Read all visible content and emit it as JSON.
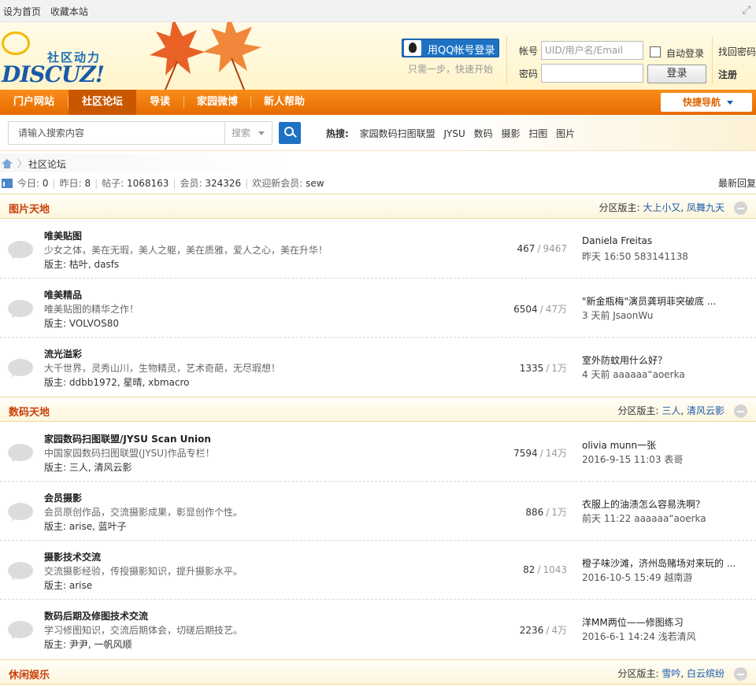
{
  "topbar": {
    "set_home": "设为首页",
    "bookmark": "收藏本站"
  },
  "header": {
    "logo_tagline": "社区动力",
    "logo_brand": "DISCUZ!",
    "qq_login": "用QQ帐号登录",
    "qq_sub": "只需一步，快速开始",
    "account_label": "帐号",
    "account_placeholder": "UID/用户名/Email",
    "password_label": "密码",
    "auto_login": "自动登录",
    "login_button": "登录",
    "forgot_password": "找回密码",
    "register": "注册"
  },
  "nav": {
    "items": [
      "门户网站",
      "社区论坛",
      "导读",
      "家园微博",
      "新人帮助"
    ],
    "active": "社区论坛",
    "quick_nav": "快捷导航"
  },
  "search": {
    "placeholder": "请输入搜索内容",
    "type": "搜索",
    "hot_label": "热搜:",
    "hot_keywords": [
      "家园数码扫图联盟",
      "JYSU",
      "数码",
      "摄影",
      "扫图",
      "图片"
    ]
  },
  "breadcrumb": {
    "current": "社区论坛"
  },
  "stats": {
    "today_label": "今日:",
    "today": "0",
    "yesterday_label": "昨日:",
    "yesterday": "8",
    "posts_label": "帖子:",
    "posts": "1068163",
    "members_label": "会员:",
    "members": "324326",
    "welcome_label": "欢迎新会员:",
    "new_member": "sew",
    "latest_reply": "最新回复"
  },
  "sections": [
    {
      "title": "图片天地",
      "mods_label": "分区版主:",
      "mods": [
        "大上小又",
        "凤舞九天"
      ],
      "forums": [
        {
          "name": "唯美贴图",
          "desc": "少女之体，美在无瑕，美人之躯，美在质雅，爱人之心，美在升华！",
          "moderators": "版主: 枯叶, dasfs",
          "threads": "467",
          "posts": "9467",
          "last_title": "Daniela Freitas",
          "last_meta": "昨天 16:50 583141138"
        },
        {
          "name": "唯美精品",
          "desc": "唯美贴图的精华之作！",
          "moderators": "版主: VOLVOS80",
          "threads": "6504",
          "posts": "47万",
          "last_title": "\"新金瓶梅\"演员龚玥菲突破底 ...",
          "last_meta": "3 天前 JsaonWu"
        },
        {
          "name": "流光溢彩",
          "desc": "大千世界，灵秀山川，生物精灵，艺术奇葩，无尽瑕想！",
          "moderators": "版主: ddbb1972, 星晴, xbmacro",
          "threads": "1335",
          "posts": "1万",
          "last_title": "室外防蚊用什么好？",
          "last_meta": "4 天前 aaaaaa“aoerka"
        }
      ]
    },
    {
      "title": "数码天地",
      "mods_label": "分区版主:",
      "mods": [
        "三人",
        "清风云影"
      ],
      "forums": [
        {
          "name": "家园数码扫图联盟/JYSU Scan Union",
          "desc": "中国家园数码扫图联盟(JYSU)作品专栏！",
          "moderators": "版主: 三人, 清风云影",
          "threads": "7594",
          "posts": "14万",
          "last_title": "olivia munn一张",
          "last_meta": "2016-9-15 11:03 表哥"
        },
        {
          "name": "会员摄影",
          "desc": "会员原创作品，交流摄影成果，彰显创作个性。",
          "moderators": "版主: arise, 蓝叶子",
          "threads": "886",
          "posts": "1万",
          "last_title": "衣服上的油渍怎么容易洗啊？",
          "last_meta": "前天 11:22 aaaaaa“aoerka"
        },
        {
          "name": "摄影技术交流",
          "desc": "交流摄影经验，传授摄影知识，提升摄影水平。",
          "moderators": "版主: arise",
          "threads": "82",
          "posts": "1043",
          "last_title": "橙子味沙滩，济州岛赌场对来玩的 ...",
          "last_meta": "2016-10-5 15:49 越南游"
        },
        {
          "name": "数码后期及修图技术交流",
          "desc": "学习修图知识，交流后期体会，切磋后期技艺。",
          "moderators": "版主: 尹尹, 一帆风顺",
          "threads": "2236",
          "posts": "4万",
          "last_title": "洋MM两位——修图练习",
          "last_meta": "2016-6-1 14:24 浅若清风"
        }
      ]
    },
    {
      "title": "休闲娱乐",
      "mods_label": "分区版主:",
      "mods": [
        "雪吟",
        "白云缤纷"
      ],
      "forums": []
    }
  ],
  "colors": {
    "nav_orange": "#f07a10",
    "section_title": "#c9400a",
    "link_blue": "#1a5aa8"
  }
}
